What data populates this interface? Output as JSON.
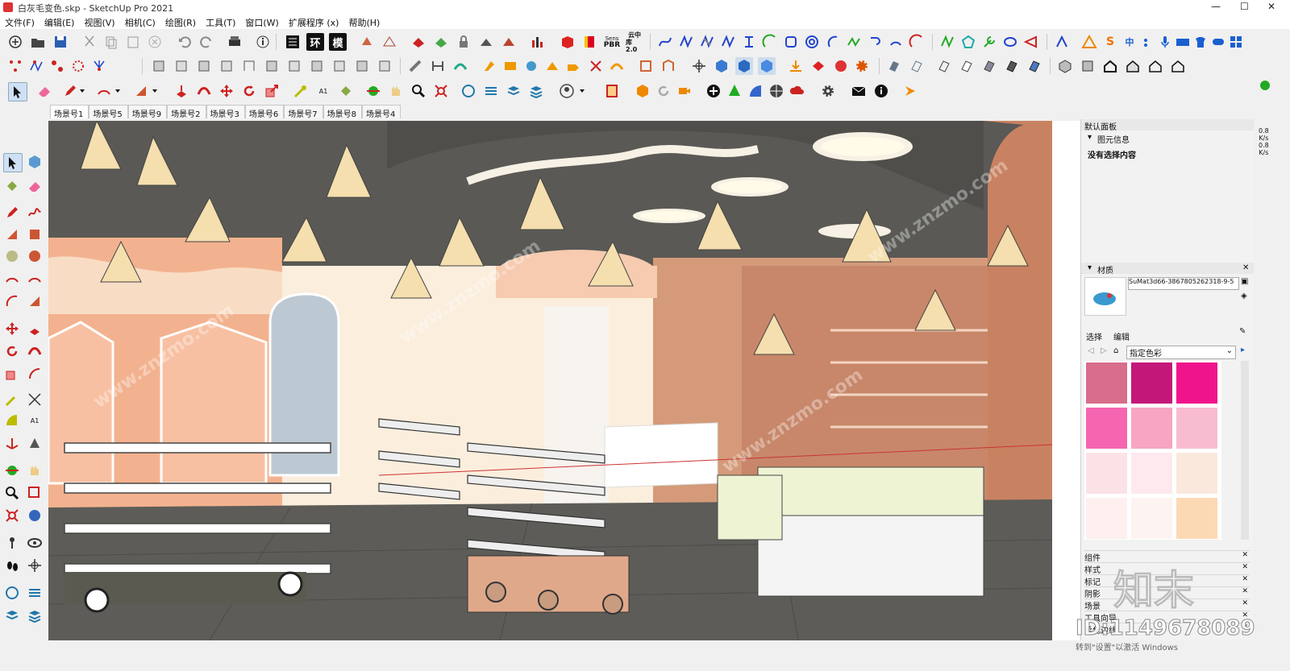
{
  "window": {
    "title": "白灰毛变色.skp - SketchUp Pro 2021",
    "minimize": "—",
    "maximize": "☐",
    "close": "✕"
  },
  "menu": [
    "文件(F)",
    "编辑(E)",
    "视图(V)",
    "相机(C)",
    "绘图(R)",
    "工具(T)",
    "窗口(W)",
    "扩展程序 (x)",
    "帮助(H)"
  ],
  "toolbar_labels": {
    "huan": "环",
    "mo": "模",
    "pbr_top": "Sens",
    "pbr": "PBR",
    "yunzhong": "云中",
    "yunku": "库2.0",
    "a1": "A1"
  },
  "ime": {
    "zhong": "中",
    "s": "S"
  },
  "scene_tabs": [
    "场景号1",
    "场景号5",
    "场景号9",
    "场景号2",
    "场景号3",
    "场景号6",
    "场景号7",
    "场景号8",
    "场景号4"
  ],
  "active_tab": 0,
  "panel": {
    "header": "默认面板",
    "entity_info": {
      "title": "图元信息",
      "status": "没有选择内容"
    },
    "materials": {
      "title": "材质",
      "name": "SuMat3d66-3867805262318-9-5",
      "tab_select": "选择",
      "tab_edit": "编辑",
      "dropdown": "指定色彩",
      "swatches": [
        "#d86e8c",
        "#c4177a",
        "#f0148c",
        "#f565b0",
        "#f7a5c2",
        "#f8bcd0",
        "#fbe2e6",
        "#fde9ee",
        "#fae8dc",
        "#fdf0ee",
        "#fdf4f2",
        "#fcd9b5"
      ]
    },
    "trays": [
      "组件",
      "样式",
      "标记",
      "阴影",
      "场景",
      "工具向导",
      "柔化边线"
    ]
  },
  "viewport": {
    "watermark": "www.znzmo.com",
    "brand": "知末",
    "id_label": "ID:1149678089"
  },
  "status": {
    "activate": "转到\"设置\"以激活 Windows"
  },
  "right_meter": {
    "a": "0.8",
    "b": "K/s",
    "c": "0.8",
    "d": "K/s"
  }
}
